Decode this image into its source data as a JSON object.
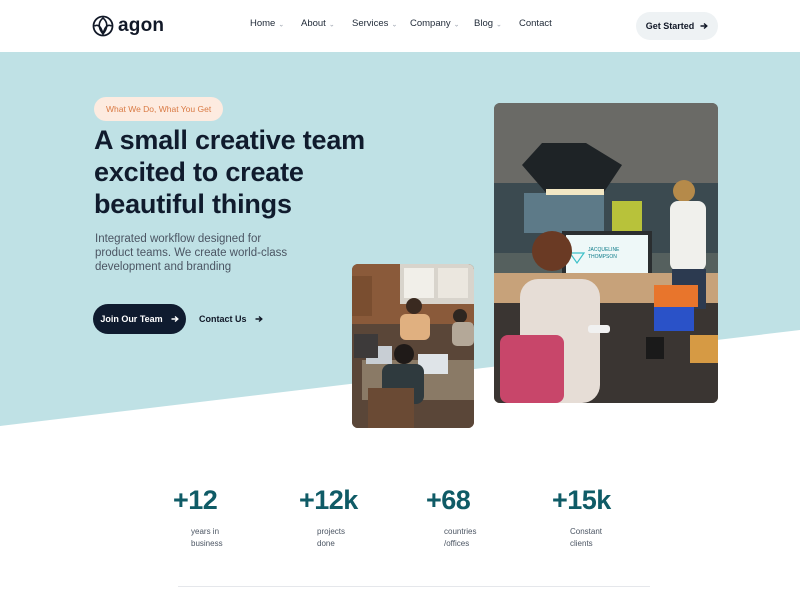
{
  "brand": {
    "name": "agon"
  },
  "nav": {
    "items": [
      {
        "label": "Home",
        "has_dropdown": true
      },
      {
        "label": "About",
        "has_dropdown": true
      },
      {
        "label": "Services",
        "has_dropdown": true
      },
      {
        "label": "Company",
        "has_dropdown": true
      },
      {
        "label": "Blog",
        "has_dropdown": true
      },
      {
        "label": "Contact",
        "has_dropdown": false
      }
    ],
    "dropdown_icon": "chevron-down-icon",
    "cta_label": "Get Started",
    "cta_icon": "arrow-right-icon"
  },
  "hero": {
    "badge": "What We Do, What You Get",
    "title_lines": [
      "A small creative team",
      "excited to create",
      "beautiful things"
    ],
    "description_lines": [
      "Integrated workflow designed for",
      "product teams. We create world-class",
      "development and branding"
    ],
    "primary_button": "Join Our Team",
    "secondary_button": "Contact Us",
    "background_color": "#bfe1e5"
  },
  "photo_screen_text": [
    "JACQUELINE",
    "THOMPSON"
  ],
  "stats": [
    {
      "value": "+12",
      "label_lines": [
        "years in",
        "business"
      ]
    },
    {
      "value": "+12k",
      "label_lines": [
        "projects",
        "done"
      ]
    },
    {
      "value": "+68",
      "label_lines": [
        "countries",
        "/offices"
      ]
    },
    {
      "value": "+15k",
      "label_lines": [
        "Constant",
        "clients"
      ]
    }
  ],
  "colors": {
    "accent_dark": "#0f1b2f",
    "stat_teal": "#0f5b66",
    "badge_bg": "#fdebe0",
    "badge_text": "#d97a44"
  }
}
